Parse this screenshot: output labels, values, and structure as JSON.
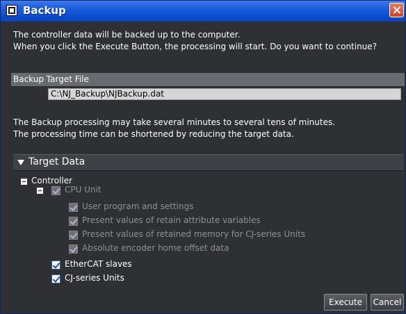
{
  "window": {
    "title": "Backup",
    "app_icon": "application-icon",
    "close_icon": "close-icon"
  },
  "intro": {
    "line1": "The controller data will be backed up to the computer.",
    "line2": "When you click the Execute Button, the processing will start. Do you want to continue?"
  },
  "backup_target": {
    "label": "Backup Target File",
    "path": "C:\\NJ_Backup\\NJBackup.dat"
  },
  "notice": {
    "line1": "The Backup processing may take several minutes to several tens of minutes.",
    "line2": "The processing time can be shortened by reducing the target data."
  },
  "target_data": {
    "header": "Target Data",
    "tree": {
      "controller": "Controller",
      "cpu_unit": "CPU Unit",
      "user_program": "User program and settings",
      "retain_vars": "Present values of retain attribute variables",
      "retained_memory": "Present values of retained memory for CJ-series Units",
      "encoder_offset": "Absolute encoder home offset data",
      "ethercat": "EtherCAT slaves",
      "cj_units": "CJ-series Units"
    }
  },
  "buttons": {
    "execute": "Execute",
    "cancel": "Cancel"
  }
}
